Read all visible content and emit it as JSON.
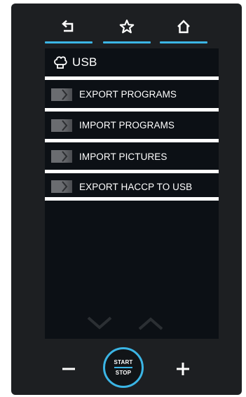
{
  "theme": {
    "accent": "#3bb5e5",
    "background": "#1d1f22",
    "screen": "#0c1015",
    "text": "#ffffff"
  },
  "topbar": {
    "back": {
      "icon": "back-arrow-icon"
    },
    "favorites": {
      "icon": "star-icon"
    },
    "home": {
      "icon": "home-icon"
    }
  },
  "breadcrumb": {
    "icon": "chef-hat-icon",
    "label": "USB"
  },
  "menu": {
    "items": [
      {
        "label": "EXPORT PROGRAMS",
        "icon": "chevron-right-icon"
      },
      {
        "label": "IMPORT PROGRAMS",
        "icon": "chevron-right-icon"
      },
      {
        "label": "IMPORT PICTURES",
        "icon": "chevron-right-icon"
      },
      {
        "label": "EXPORT HACCP TO USB",
        "icon": "chevron-right-icon"
      }
    ]
  },
  "scroll": {
    "down": {
      "icon": "chevron-down-icon"
    },
    "up": {
      "icon": "chevron-up-icon"
    }
  },
  "controls": {
    "minus_icon": "minus-icon",
    "plus_icon": "plus-icon",
    "start_label": "START",
    "stop_label": "STOP"
  }
}
